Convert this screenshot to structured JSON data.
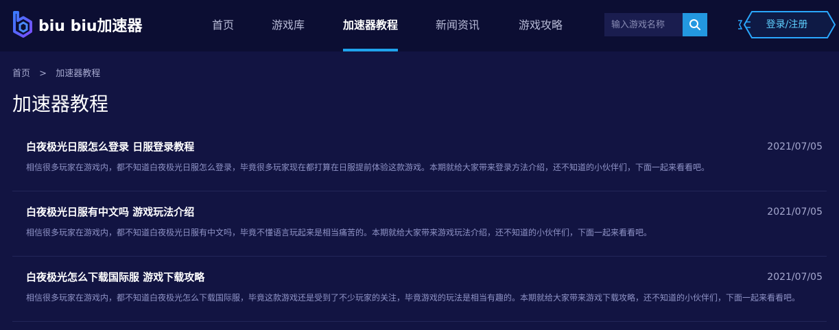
{
  "brand": {
    "name": "biu biu加速器"
  },
  "nav": [
    {
      "label": "首页",
      "active": false
    },
    {
      "label": "游戏库",
      "active": false
    },
    {
      "label": "加速器教程",
      "active": true
    },
    {
      "label": "新闻资讯",
      "active": false
    },
    {
      "label": "游戏攻略",
      "active": false
    }
  ],
  "search": {
    "placeholder": "输入游戏名称",
    "icon": "search-icon"
  },
  "login": {
    "label": "登录/注册"
  },
  "breadcrumb": {
    "home": "首页",
    "separator": ">",
    "current": "加速器教程"
  },
  "page_title": "加速器教程",
  "articles": [
    {
      "title": "白夜极光日服怎么登录 日服登录教程",
      "date": "2021/07/05",
      "summary": "相信很多玩家在游戏内，都不知道白夜极光日服怎么登录，毕竟很多玩家现在都打算在日服提前体验这款游戏。本期就给大家带来登录方法介绍，还不知道的小伙伴们，下面一起来看看吧。"
    },
    {
      "title": "白夜极光日服有中文吗 游戏玩法介绍",
      "date": "2021/07/05",
      "summary": "相信很多玩家在游戏内，都不知道白夜极光日服有中文吗，毕竟不懂语言玩起来是相当痛苦的。本期就给大家带来游戏玩法介绍，还不知道的小伙伴们，下面一起来看看吧。"
    },
    {
      "title": "白夜极光怎么下载国际服 游戏下载攻略",
      "date": "2021/07/05",
      "summary": "相信很多玩家在游戏内，都不知道白夜极光怎么下载国际服，毕竟这款游戏还是受到了不少玩家的关注，毕竟游戏的玩法是相当有趣的。本期就给大家带来游戏下载攻略，还不知道的小伙伴们，下面一起来看看吧。"
    }
  ],
  "colors": {
    "background": "#121442",
    "header": "#0c0e33",
    "accent": "#1fa3ec",
    "login_text": "#5fd0ff"
  }
}
